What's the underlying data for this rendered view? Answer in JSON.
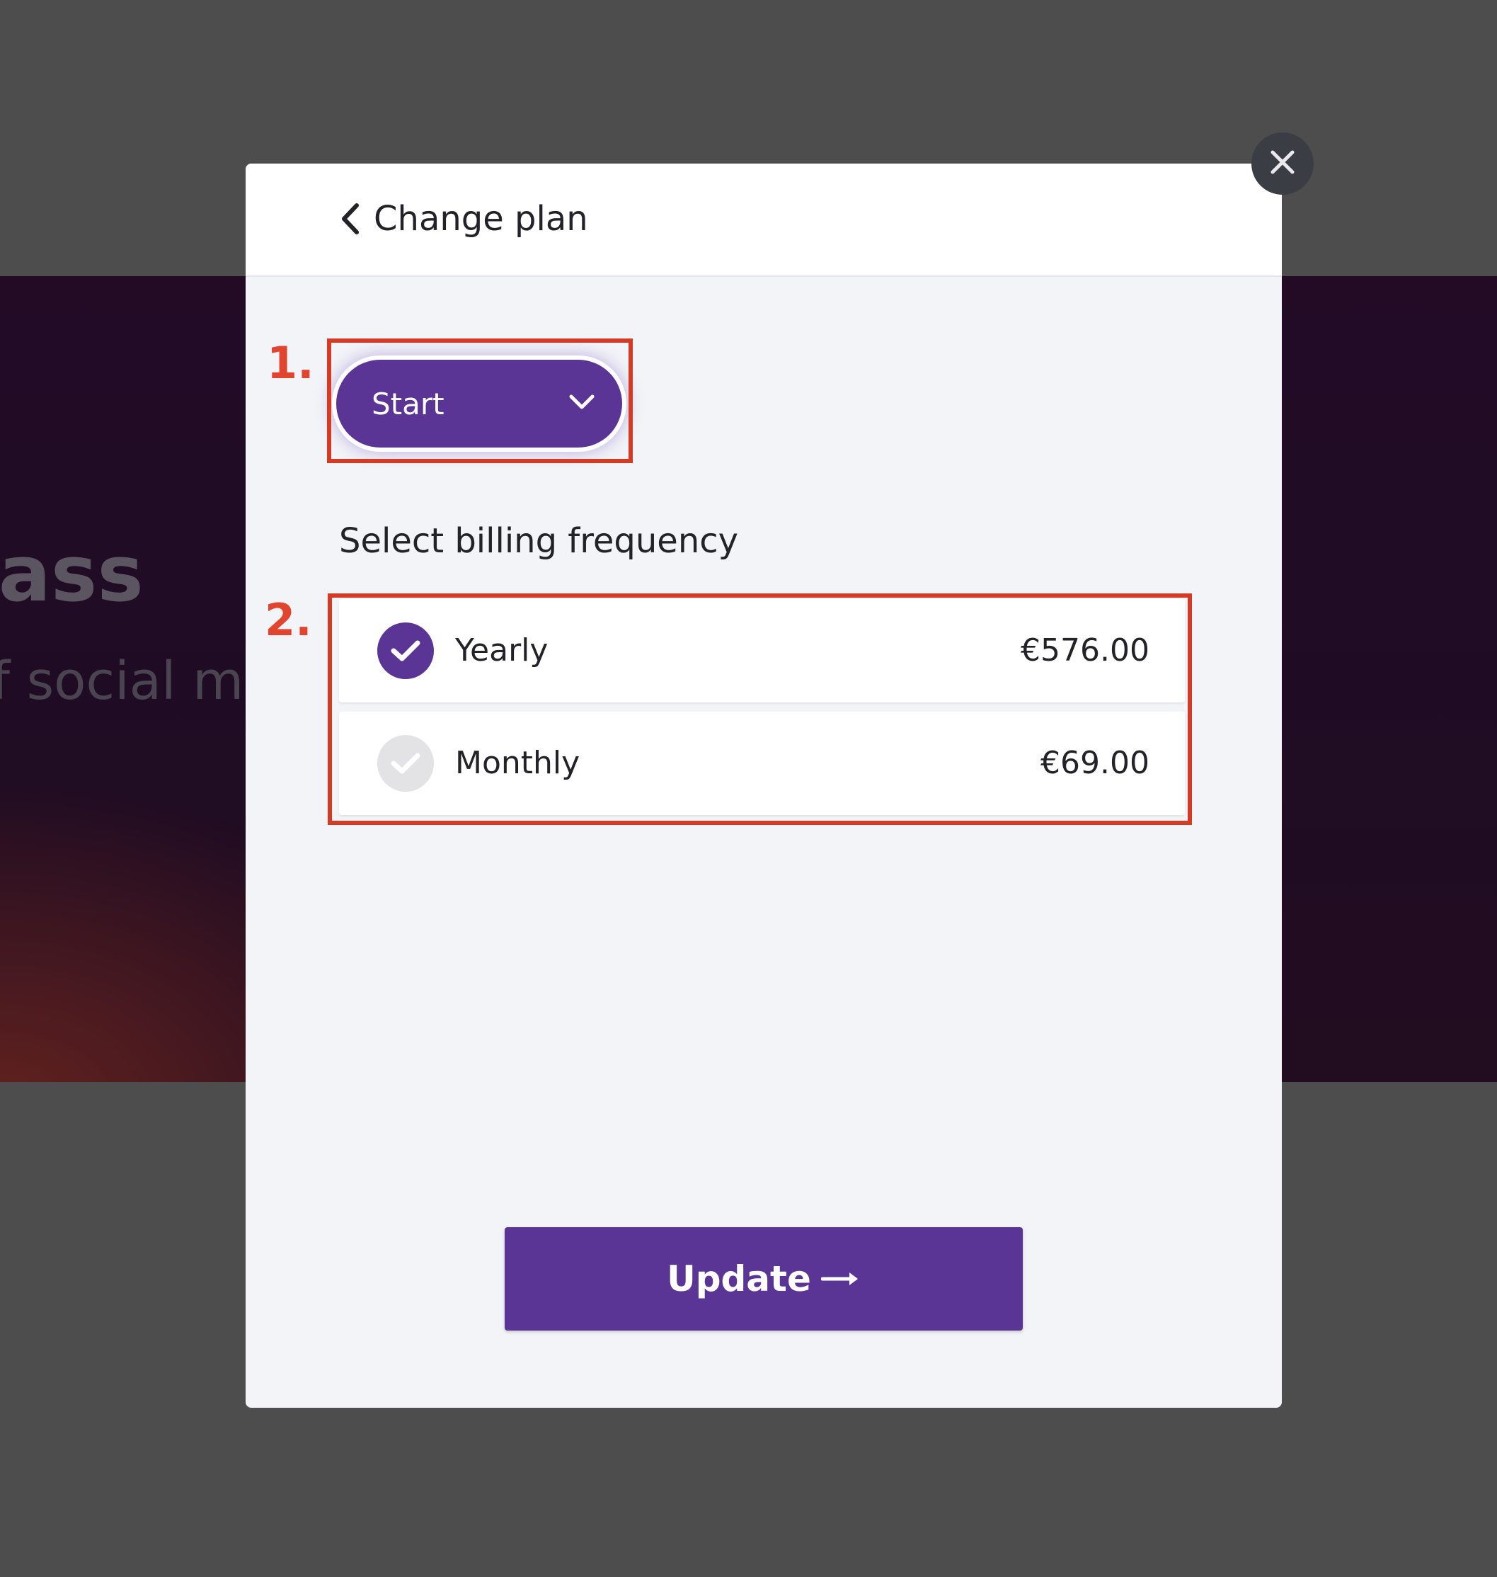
{
  "background": {
    "headline_fragment": "lass",
    "subtitle_fragment": "f social m"
  },
  "modal": {
    "title": "Change plan",
    "back_icon": "chevron-left-icon",
    "close_icon": "close-icon"
  },
  "annotations": {
    "step_1": "1.",
    "step_2": "2."
  },
  "plan_selector": {
    "selected": "Start",
    "icon": "chevron-down-icon"
  },
  "billing": {
    "label": "Select billing frequency",
    "options": [
      {
        "label": "Yearly",
        "price": "€576.00",
        "selected": true
      },
      {
        "label": "Monthly",
        "price": "€69.00",
        "selected": false
      }
    ]
  },
  "actions": {
    "update_label": "Update",
    "update_icon": "arrow-right-icon"
  },
  "colors": {
    "accent": "#5b3595",
    "annotation": "#d53a24",
    "overlay": "#4d4d4d",
    "modal_bg": "#f3f4f8"
  }
}
